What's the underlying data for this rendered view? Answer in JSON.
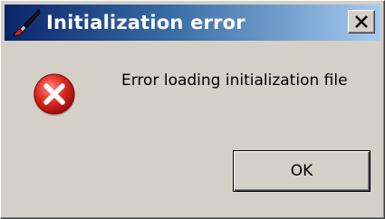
{
  "dialog": {
    "title": "Initialization error",
    "message": "Error loading initialization file",
    "ok_label": "OK",
    "icons": {
      "title": "brush-icon",
      "status": "error-icon",
      "close": "close-icon"
    },
    "colors": {
      "title_bar_start": "#0a246a",
      "title_bar_end": "#a6caf0",
      "error_red": "#d0201a",
      "window_face": "#d4d0c8"
    }
  }
}
